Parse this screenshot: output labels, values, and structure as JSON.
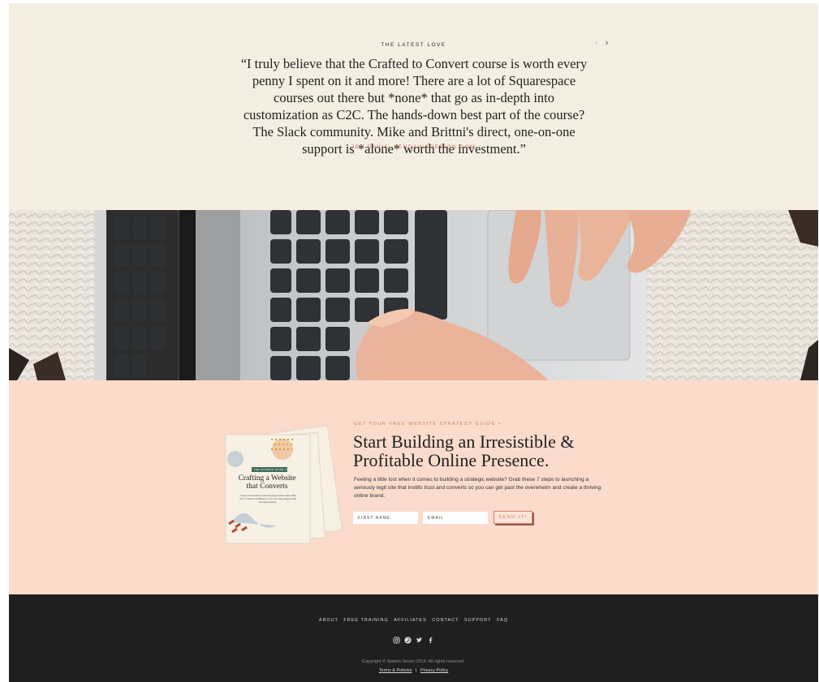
{
  "testimonial": {
    "eyebrow": "THE LATEST LOVE",
    "prev_icon": "chevron-left-icon",
    "next_icon": "chevron-right-icon",
    "prev_label": "‹",
    "next_label": "›",
    "quote": "“I truly believe that the Crafted to Convert course is worth every penny I spent on it and more! There are a lot of Squarespace courses out there but *none* that go as in-depth into customization as C2C.  The hands-down best part of the course? The Slack community. Mike and Brittni's direct, one-on-one support is *alone* worth the investment.”",
    "author": "JEN DAVIS, JENDAVISDESIGN.COM"
  },
  "hero": {
    "description_icon": "laptop-photo"
  },
  "optin": {
    "eyebrow": "GET YOUR FREE WEBSITE STRATEGY GUIDE +",
    "title": "Start Building an Irresistible & Profitable Online Presence.",
    "description": "Feeling a little lost when it comes to building a strategic website? Grab these 7 steps to launching a seriously legit site that instills trust and converts so you can get past the overwhelm and create a thriving online brand.",
    "first_name_placeholder": "FIRST NAME",
    "email_placeholder": "EMAIL",
    "submit_label": "SEND IT!",
    "book": {
      "tag": "THE ULTIMATE GUIDE TO",
      "title_line1": "Crafting a Website",
      "title_line2": "that Converts",
      "subtitle": "7 steps to launching a seriously legit website that instills trust + inspires confidence so you can stop playing small and start growing."
    }
  },
  "footer": {
    "nav": [
      "ABOUT",
      "FREE TRAINING",
      "AFFILIATES",
      "CONTACT",
      "SUPPORT",
      "FAQ"
    ],
    "socials": [
      "instagram-icon",
      "pinterest-icon",
      "twitter-icon",
      "facebook-icon"
    ],
    "copyright": "Copyright © Station Seven 2019. All rights reserved.",
    "terms": "Terms & Policies",
    "separator": "|",
    "privacy": "Privacy Policy"
  },
  "colors": {
    "cream": "#f5efe3",
    "peach": "#fadbcc",
    "accent": "#c0735a",
    "footer": "#1f1f1f"
  }
}
